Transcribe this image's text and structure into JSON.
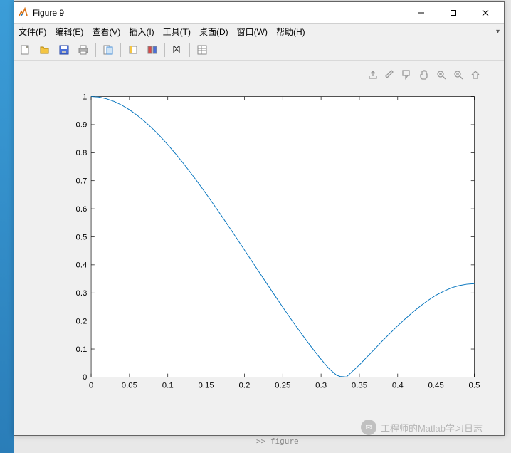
{
  "window": {
    "title": "Figure 9"
  },
  "menu": {
    "file": "文件(F)",
    "edit": "编辑(E)",
    "view": "查看(V)",
    "insert": "插入(I)",
    "tools": "工具(T)",
    "desktop": "桌面(D)",
    "window": "窗口(W)",
    "help": "帮助(H)"
  },
  "axes_toolbar": {
    "export": "export-icon",
    "brush": "brush-icon",
    "datatip": "datatip-icon",
    "pan": "pan-icon",
    "zoomin": "zoom-in-icon",
    "zoomout": "zoom-out-icon",
    "home": "home-icon"
  },
  "watermark": "工程师的Matlab学习日志",
  "bg_snippet": ">> figure",
  "chart_data": {
    "type": "line",
    "title": "",
    "xlabel": "",
    "ylabel": "",
    "xlim": [
      0,
      0.5
    ],
    "ylim": [
      0,
      1
    ],
    "xticks": [
      0,
      0.05,
      0.1,
      0.15,
      0.2,
      0.25,
      0.3,
      0.35,
      0.4,
      0.45,
      0.5
    ],
    "yticks": [
      0,
      0.1,
      0.2,
      0.3,
      0.4,
      0.5,
      0.6,
      0.7,
      0.8,
      0.9,
      1
    ],
    "x": [
      0,
      0.01,
      0.02,
      0.03,
      0.04,
      0.05,
      0.06,
      0.07,
      0.08,
      0.09,
      0.1,
      0.11,
      0.12,
      0.13,
      0.14,
      0.15,
      0.16,
      0.17,
      0.18,
      0.19,
      0.2,
      0.21,
      0.22,
      0.23,
      0.24,
      0.25,
      0.26,
      0.27,
      0.28,
      0.29,
      0.3,
      0.31,
      0.32,
      0.325,
      0.33,
      0.333,
      0.34,
      0.35,
      0.36,
      0.37,
      0.38,
      0.39,
      0.4,
      0.41,
      0.42,
      0.43,
      0.44,
      0.45,
      0.46,
      0.47,
      0.48,
      0.49,
      0.5
    ],
    "y": [
      1.0,
      0.9982,
      0.9921,
      0.9826,
      0.9694,
      0.953,
      0.9336,
      0.9111,
      0.886,
      0.8584,
      0.8286,
      0.7967,
      0.7631,
      0.7279,
      0.6914,
      0.6536,
      0.6148,
      0.5753,
      0.5351,
      0.4943,
      0.4533,
      0.4121,
      0.371,
      0.33,
      0.2894,
      0.2492,
      0.2098,
      0.1712,
      0.1338,
      0.0977,
      0.0633,
      0.031,
      0.007,
      0.002,
      0.001,
      0.0,
      0.018,
      0.043,
      0.072,
      0.1,
      0.129,
      0.156,
      0.183,
      0.208,
      0.232,
      0.254,
      0.274,
      0.292,
      0.306,
      0.318,
      0.326,
      0.331,
      0.333
    ],
    "line_color": "#0072BD"
  }
}
